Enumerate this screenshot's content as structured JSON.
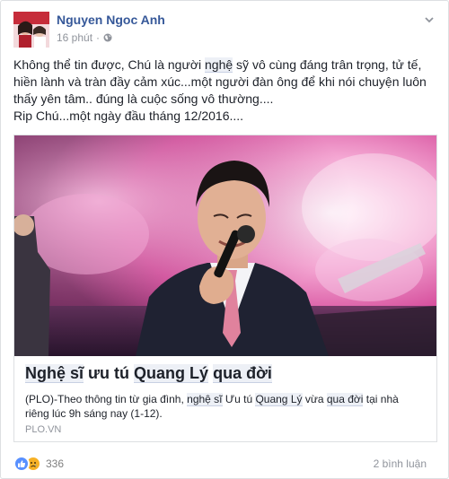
{
  "post": {
    "author": "Nguyen Ngoc Anh",
    "time": "16 phút",
    "privacy_icon": "globe-icon",
    "menu_icon": "chevron-down-icon",
    "text": {
      "line1_pre": "Không thể tin được, Chú là người ",
      "line1_hl": "nghệ",
      "line1_post": " sỹ vô cùng đáng trân trọng, tử tế,",
      "line2": "hiền lành và tràn đầy cảm xúc...một người đàn ông để khi nói chuyện luôn",
      "line3": "thấy yên tâm.. đúng là cuộc sống vô thường....",
      "line4": "Rip Chú...một ngày đầu tháng 12/2016...."
    }
  },
  "card": {
    "title": {
      "t1": "Nghệ sĩ",
      "t2": " ưu tú ",
      "t3": "Quang Lý",
      "t4": " ",
      "t5": "qua đời"
    },
    "desc": {
      "d1": "(PLO)-Theo thông tin từ gia đình, ",
      "d2": "nghệ sĩ",
      "d3": " Ưu tú ",
      "d4": "Quang Lý",
      "d5": " vừa ",
      "d6": "qua đời",
      "d7": " tại nhà",
      "d8": "riêng lúc 9h sáng nay (1-12)."
    },
    "source": "PLO.VN"
  },
  "footer": {
    "reaction_count": "336",
    "comments": "2 bình luận",
    "like_icon": "like-icon",
    "sad_icon": "sad-icon"
  },
  "colors": {
    "link_blue": "#365899",
    "meta_gray": "#90949c",
    "border": "#dddfe2",
    "like_blue": "#5890ff",
    "sad_yellow": "#f7b125"
  }
}
